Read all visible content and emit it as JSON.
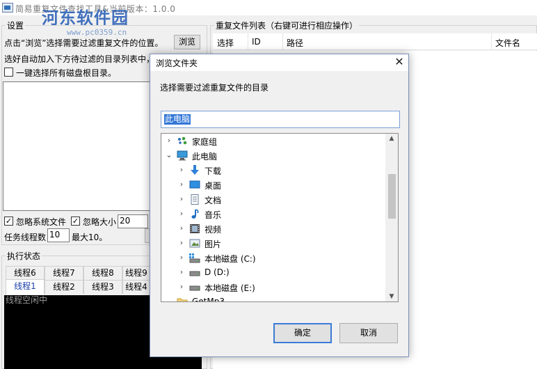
{
  "window": {
    "title": "简易重复文件查找工具&当前版本：1.0.0",
    "watermark": "河东软件园",
    "watermark_url": "www.pc0359.cn"
  },
  "settings": {
    "group_title": "设置",
    "instruction": "点击“浏览”选择需要过滤重复文件的位置。",
    "browse_label": "浏览",
    "auto_add_hint": "选好自动加入下方待过滤的目录列表中，",
    "select_all_disks_label": "一键选择所有磁盘根目录。",
    "select_all_disks_checked": false,
    "ignore_system_label": "忽略系统文件",
    "ignore_system_checked": true,
    "ignore_size_label": "忽略大小",
    "ignore_size_checked": true,
    "ignore_size_value": "20",
    "thread_count_label": "任务线程数",
    "thread_count_value": "10",
    "thread_max_label": "最大10。"
  },
  "status": {
    "group_title": "执行状态",
    "tabs_row1": [
      "线程6",
      "线程7",
      "线程8",
      "线程9"
    ],
    "tabs_row2": [
      "线程1",
      "线程2",
      "线程3",
      "线程4"
    ],
    "active_tab": "线程1",
    "console_text": "线程空闲中"
  },
  "results": {
    "group_title": "重复文件列表（右键可进行相应操作）",
    "columns": [
      "选择",
      "ID",
      "路径",
      "文件名"
    ]
  },
  "dialog": {
    "title": "浏览文件夹",
    "close_glyph": "✕",
    "description": "选择需要过滤重复文件的目录",
    "path_value": "此电脑",
    "ok_label": "确定",
    "cancel_label": "取消",
    "tree": [
      {
        "label": "家庭组",
        "icon": "homegroup-icon",
        "expander": "›"
      },
      {
        "label": "此电脑",
        "icon": "computer-icon",
        "expander": "⌄"
      },
      {
        "label": "下载",
        "icon": "download-folder-icon",
        "expander": "›"
      },
      {
        "label": "桌面",
        "icon": "desktop-folder-icon",
        "expander": "›"
      },
      {
        "label": "文档",
        "icon": "documents-folder-icon",
        "expander": "›"
      },
      {
        "label": "音乐",
        "icon": "music-folder-icon",
        "expander": "›"
      },
      {
        "label": "视频",
        "icon": "videos-folder-icon",
        "expander": "›"
      },
      {
        "label": "图片",
        "icon": "pictures-folder-icon",
        "expander": "›"
      },
      {
        "label": "本地磁盘 (C:)",
        "icon": "system-drive-icon",
        "expander": "›"
      },
      {
        "label": "D (D:)",
        "icon": "drive-icon",
        "expander": "›"
      },
      {
        "label": "本地磁盘 (E:)",
        "icon": "drive-icon",
        "expander": "›"
      },
      {
        "label": "GetMp3",
        "icon": "folder-icon",
        "expander": ""
      }
    ]
  }
}
